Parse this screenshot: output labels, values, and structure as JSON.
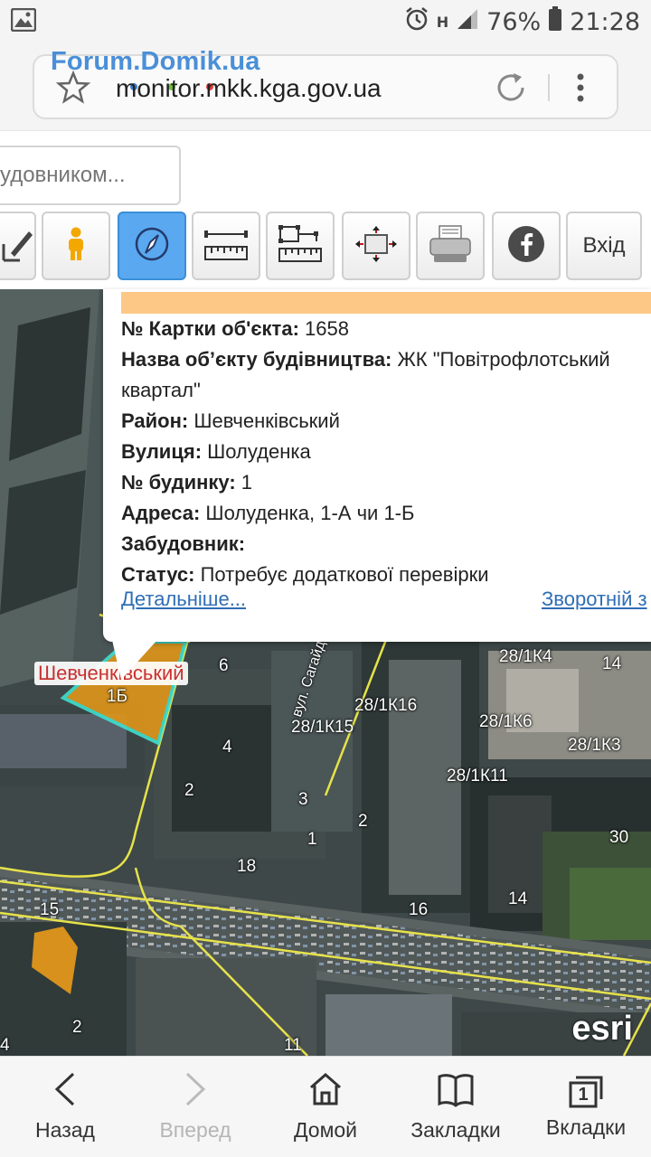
{
  "status_bar": {
    "battery": "76%",
    "time": "21:28",
    "network_label": "H"
  },
  "browser": {
    "watermark": "Forum.Domik.ua",
    "url": "monitor.mkk.kga.gov.ua"
  },
  "search": {
    "placeholder": "удовником..."
  },
  "toolbar": {
    "login_label": "Вхід"
  },
  "popup": {
    "rows": [
      {
        "label": "№ Картки об'єкта:",
        "value": " 1658"
      },
      {
        "label": "Назва об’єкту будівництва:",
        "value": " ЖК \"Повітрофлотський квартал\""
      },
      {
        "label": "Район:",
        "value": " Шевченківський"
      },
      {
        "label": "Вулиця:",
        "value": " Шолуденка"
      },
      {
        "label": "№ будинку:",
        "value": " 1"
      },
      {
        "label": "Адреса:",
        "value": " Шолуденка, 1-А чи 1-Б"
      },
      {
        "label": "Забудовник:",
        "value": ""
      },
      {
        "label": "Статус:",
        "value": " Потребує додаткової перевірки"
      }
    ],
    "details_link": "Детальніше...",
    "feedback_link": "Зворотній з"
  },
  "map": {
    "district_label": "Шевченківський",
    "plot_label": "1Б",
    "labels": [
      "6",
      "28/1К4",
      "14",
      "28/1К16",
      "28/1К15",
      "28/1К6",
      "4",
      "28/1К3",
      "2",
      "3",
      "28/1К11",
      "2",
      "1",
      "30",
      "18",
      "16",
      "14",
      "15",
      "2",
      "4",
      "11",
      "вул. Сагайдака"
    ],
    "attribution": "esri"
  },
  "bottom_nav": {
    "items": [
      {
        "label": "Назад",
        "enabled": true
      },
      {
        "label": "Вперед",
        "enabled": false
      },
      {
        "label": "Домой",
        "enabled": true
      },
      {
        "label": "Закладки",
        "enabled": true
      },
      {
        "label": "Вкладки",
        "enabled": true
      }
    ],
    "tabs_count": "1"
  },
  "colors": {
    "popup_header": "#fdc886",
    "link": "#2f6eb5",
    "active_tool": "#5aa8f0",
    "parcel_fill": "#e0961a",
    "parcel_outline": "#3ee0d0",
    "map_lines": "#e6e24a"
  }
}
